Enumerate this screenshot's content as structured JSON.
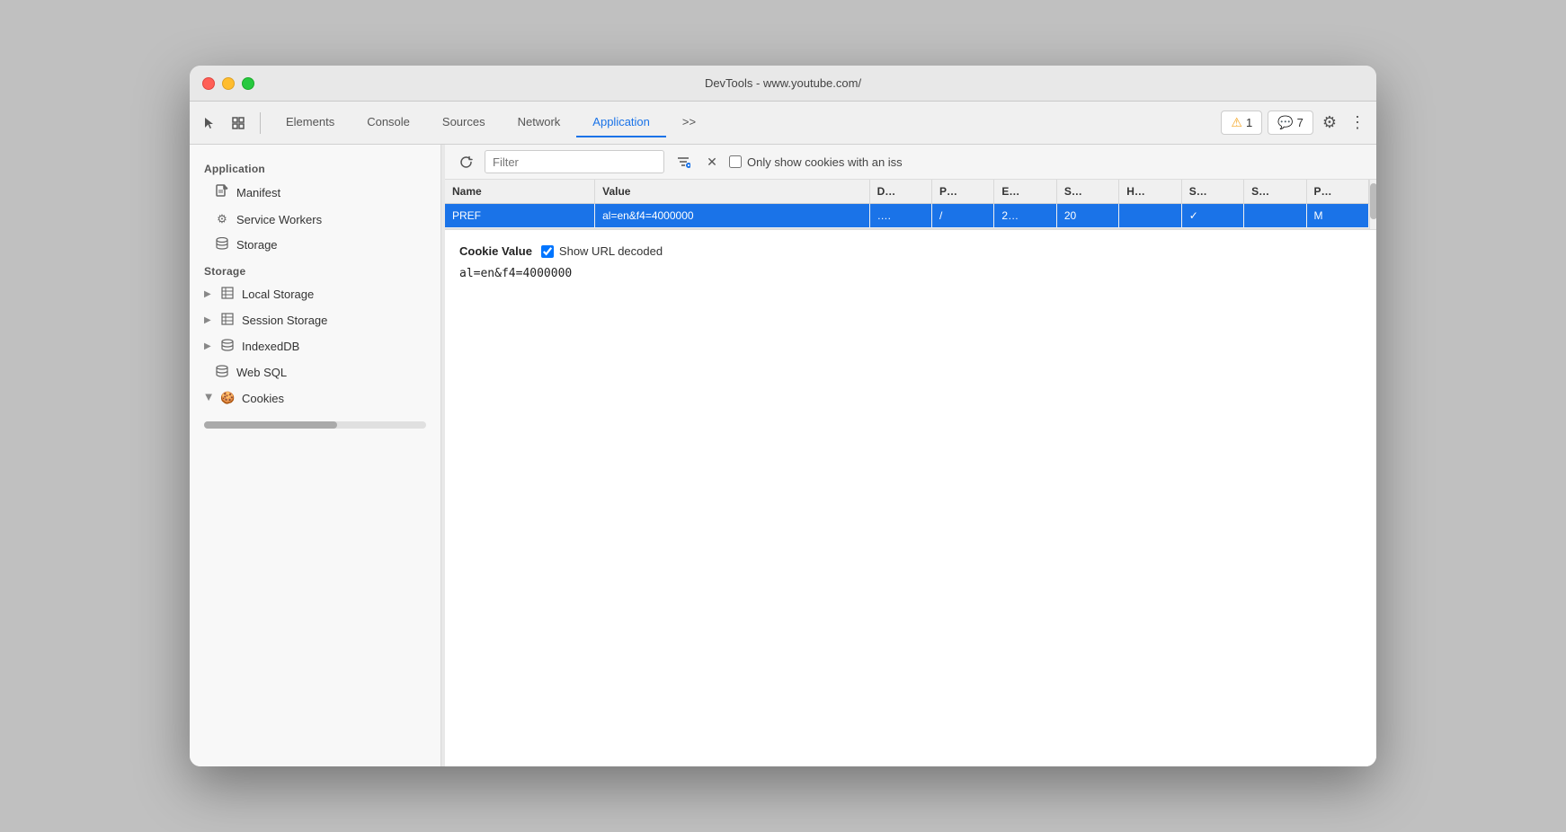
{
  "window": {
    "title": "DevTools - www.youtube.com/"
  },
  "toolbar": {
    "tabs": [
      {
        "id": "elements",
        "label": "Elements",
        "active": false
      },
      {
        "id": "console",
        "label": "Console",
        "active": false
      },
      {
        "id": "sources",
        "label": "Sources",
        "active": false
      },
      {
        "id": "network",
        "label": "Network",
        "active": false
      },
      {
        "id": "application",
        "label": "Application",
        "active": true
      }
    ],
    "more_tabs_label": ">>",
    "warning_count": "1",
    "chat_count": "7"
  },
  "sidebar": {
    "application_section": "Application",
    "items_application": [
      {
        "id": "manifest",
        "label": "Manifest",
        "icon": "📄",
        "has_arrow": false
      },
      {
        "id": "service-workers",
        "label": "Service Workers",
        "icon": "⚙",
        "has_arrow": false
      },
      {
        "id": "storage",
        "label": "Storage",
        "icon": "🗄",
        "has_arrow": false
      }
    ],
    "storage_section": "Storage",
    "items_storage": [
      {
        "id": "local-storage",
        "label": "Local Storage",
        "icon": "▦",
        "has_arrow": true,
        "expanded": false
      },
      {
        "id": "session-storage",
        "label": "Session Storage",
        "icon": "▦",
        "has_arrow": true,
        "expanded": false
      },
      {
        "id": "indexeddb",
        "label": "IndexedDB",
        "icon": "🗄",
        "has_arrow": true,
        "expanded": false
      },
      {
        "id": "web-sql",
        "label": "Web SQL",
        "icon": "🗄",
        "has_arrow": false
      },
      {
        "id": "cookies",
        "label": "Cookies",
        "icon": "🍪",
        "has_arrow": true,
        "expanded": true
      }
    ]
  },
  "panel": {
    "filter_placeholder": "Filter",
    "only_cookies_label": "Only show cookies with an iss",
    "table": {
      "columns": [
        {
          "id": "name",
          "label": "Name"
        },
        {
          "id": "value",
          "label": "Value"
        },
        {
          "id": "domain",
          "label": "D…"
        },
        {
          "id": "path",
          "label": "P…"
        },
        {
          "id": "expires",
          "label": "E…"
        },
        {
          "id": "size",
          "label": "S…"
        },
        {
          "id": "httponly",
          "label": "H…"
        },
        {
          "id": "secure",
          "label": "S…"
        },
        {
          "id": "samesite",
          "label": "S…"
        },
        {
          "id": "priority",
          "label": "P…"
        }
      ],
      "rows": [
        {
          "name": "PREF",
          "value": "al=en&f4=4000000",
          "domain": "….",
          "path": "/",
          "expires": "2…",
          "size": "20",
          "httponly": "",
          "secure": "✓",
          "samesite": "",
          "priority": "M",
          "selected": true
        }
      ]
    },
    "detail": {
      "title": "Cookie Value",
      "show_decoded_label": "Show URL decoded",
      "value": "al=en&f4=4000000"
    }
  }
}
